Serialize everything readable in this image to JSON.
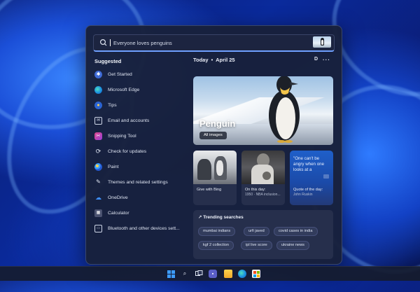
{
  "search": {
    "value": "Everyone loves penguins"
  },
  "suggested": {
    "title": "Suggested",
    "items": [
      {
        "label": "Get Started",
        "icon": "get-started-icon"
      },
      {
        "label": "Microsoft Edge",
        "icon": "edge-icon"
      },
      {
        "label": "Tips",
        "icon": "tips-icon"
      },
      {
        "label": "Email and accounts",
        "icon": "email-icon"
      },
      {
        "label": "Snipping Tool",
        "icon": "snipping-tool-icon"
      },
      {
        "label": "Check for updates",
        "icon": "update-icon"
      },
      {
        "label": "Paint",
        "icon": "paint-icon"
      },
      {
        "label": "Themes and related settings",
        "icon": "themes-icon"
      },
      {
        "label": "OneDrive",
        "icon": "onedrive-icon"
      },
      {
        "label": "Calculator",
        "icon": "calculator-icon"
      },
      {
        "label": "Bluetooth and other devices sett...",
        "icon": "bluetooth-icon"
      }
    ]
  },
  "today": {
    "heading": "Today",
    "separator": "•",
    "date": "April 25",
    "more": "···"
  },
  "hero": {
    "title": "Penguin",
    "button": "All images"
  },
  "cards": [
    {
      "caption": "Give with Bing",
      "sub": ""
    },
    {
      "caption": "On this day:",
      "sub": "1950 · NBA inclusion..."
    },
    {
      "quote": "\"One can't be angry when one looks at a",
      "caption": "Quote of the day:",
      "sub": "John Ruskin"
    }
  ],
  "trending": {
    "title": "Trending searches",
    "chips": [
      "mumbai indians",
      "urfi javed",
      "covid cases in india",
      "kgf 2 collection",
      "ipl live score",
      "ukraine news"
    ]
  },
  "colors": {
    "accent": "#6fa0ff",
    "panel": "#18203a",
    "quote_card": "#1f5fc9"
  }
}
